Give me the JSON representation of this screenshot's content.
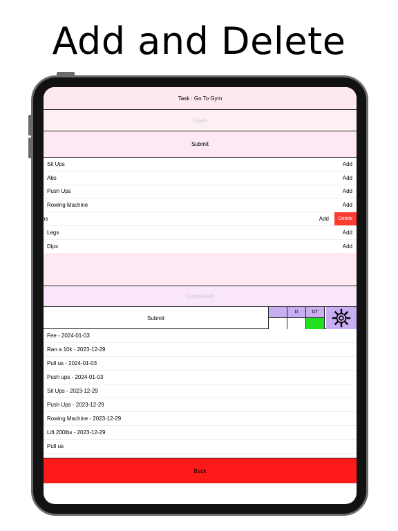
{
  "headline": "Add and Delete",
  "task_label": "Task : Go To Gym",
  "goals_placeholder": "Goals",
  "submit_label": "Submit",
  "goals": [
    {
      "name": "Sit Ups",
      "action": "Add"
    },
    {
      "name": "Abs",
      "action": "Add"
    },
    {
      "name": "Push Ups",
      "action": "Add"
    },
    {
      "name": "Rowing Machine",
      "action": "Add"
    },
    {
      "name": "bs",
      "action": "Add",
      "delete": "Delete"
    },
    {
      "name": "Legs",
      "action": "Add"
    },
    {
      "name": "Dips",
      "action": "Add"
    }
  ],
  "completed_placeholder": "Completed",
  "controls": {
    "submit_label": "Submit",
    "col1_header": "",
    "col2_header": "D",
    "col3_header": "DT"
  },
  "completed": [
    "Fee - 2024-01-03",
    "Ran a 10k - 2023-12-29",
    "Pull us - 2024-01-03",
    "Push ups - 2024-01-03",
    "Sit Ups - 2023-12-29",
    "Push Ups - 2023-12-29",
    "Rowing Machine - 2023-12-29",
    "Lift 200lbs - 2023-12-29",
    "Pull us"
  ],
  "back_label": "Back",
  "colors": {
    "delete": "#ff3b30",
    "back": "#ff1a1a",
    "purple": "#c9aef2",
    "green": "#22e01f"
  },
  "icons": {
    "settings": "gear-icon"
  }
}
